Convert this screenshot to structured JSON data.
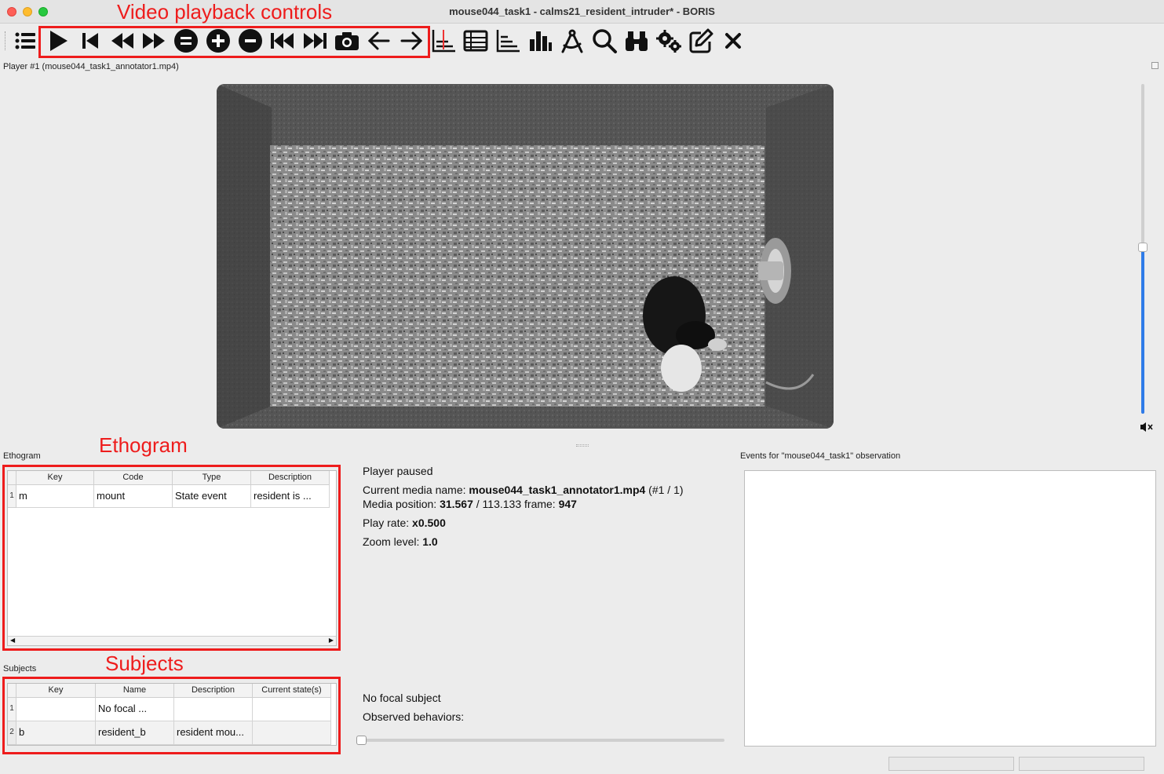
{
  "window": {
    "title": "mouse044_task1 - calms21_resident_intruder* - BORIS"
  },
  "toolbar": {
    "annotation_label": "Video playback controls",
    "tools": [
      {
        "name": "menu-list-icon"
      },
      {
        "name": "play-icon"
      },
      {
        "name": "skip-to-start-icon"
      },
      {
        "name": "rewind-icon"
      },
      {
        "name": "fast-forward-icon"
      },
      {
        "name": "reset-speed-icon"
      },
      {
        "name": "speed-up-icon"
      },
      {
        "name": "speed-down-icon"
      },
      {
        "name": "previous-media-icon"
      },
      {
        "name": "next-media-icon"
      },
      {
        "name": "camera-icon"
      },
      {
        "name": "arrow-left-icon"
      },
      {
        "name": "arrow-right-icon"
      },
      {
        "name": "plot-events-icon"
      },
      {
        "name": "table-icon"
      },
      {
        "name": "time-budget-icon"
      },
      {
        "name": "bar-chart-icon"
      },
      {
        "name": "geometric-measurement-icon"
      },
      {
        "name": "search-icon"
      },
      {
        "name": "binoculars-icon"
      },
      {
        "name": "settings-gears-icon"
      },
      {
        "name": "edit-icon"
      },
      {
        "name": "close-icon"
      }
    ]
  },
  "player": {
    "label": "Player #1 (mouse044_task1_annotator1.mp4)",
    "volume_level": 0.5
  },
  "ethogram": {
    "label": "Ethogram",
    "annotation_label": "Ethogram",
    "columns": [
      "Key",
      "Code",
      "Type",
      "Description"
    ],
    "rows": [
      {
        "num": "1",
        "key": "m",
        "code": "mount",
        "type": "State event",
        "description": "resident is ..."
      }
    ]
  },
  "subjects": {
    "label": "Subjects",
    "annotation_label": "Subjects",
    "columns": [
      "Key",
      "Name",
      "Description",
      "Current state(s)"
    ],
    "rows": [
      {
        "num": "1",
        "key": "",
        "name": "No focal ...",
        "description": "",
        "state": ""
      },
      {
        "num": "2",
        "key": "b",
        "name": "resident_b",
        "description": "resident mou...",
        "state": ""
      }
    ]
  },
  "status": {
    "state": "Player paused",
    "media_name_label": "Current media name: ",
    "media_name": "mouse044_task1_annotator1.mp4",
    "media_index": " (#1 / 1)",
    "position_label": "Media position: ",
    "position": "31.567",
    "duration": " / 113.133 frame: ",
    "frame": "947",
    "rate_label": "Play rate: ",
    "rate": "x0.500",
    "zoom_label": "Zoom level: ",
    "zoom": "1.0",
    "focal_subject": "No focal subject",
    "observed_behaviors": "Observed behaviors:"
  },
  "events": {
    "label": "Events for \"mouse044_task1\" observation"
  },
  "colors": {
    "annotation_red": "#ee1c1c",
    "slider_blue": "#2f7be8"
  }
}
